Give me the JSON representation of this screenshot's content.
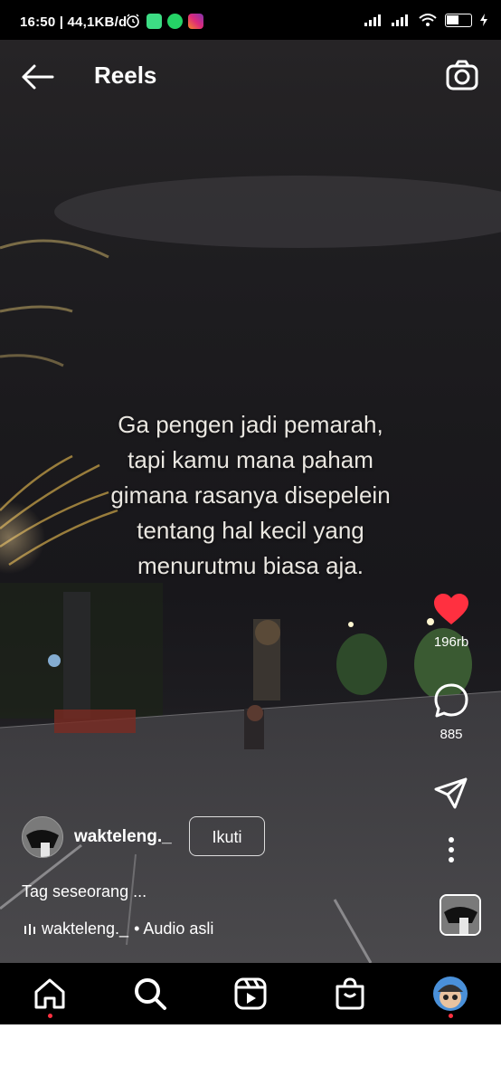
{
  "status_bar": {
    "time": "16:50",
    "network_speed": "44,1KB/d",
    "battery": "46"
  },
  "header": {
    "title": "Reels"
  },
  "caption": {
    "lines": [
      "Ga pengen jadi pemarah,",
      "tapi kamu mana paham",
      "gimana rasanya disepelein",
      "tentang hal kecil yang",
      "menurutmu biasa aja."
    ]
  },
  "actions": {
    "likes": "196rb",
    "comments": "885"
  },
  "post": {
    "username": "wakteleng._",
    "follow_label": "Ikuti",
    "tag_text": "Tag seseorang ...",
    "audio_user": "wakteleng._",
    "audio_suffix": "• Audio asli"
  },
  "colors": {
    "like_red": "#ff3040",
    "background": "#000000"
  },
  "icons": [
    "back-arrow",
    "camera",
    "heart",
    "comment",
    "share",
    "more-vertical",
    "home",
    "search",
    "reels",
    "shop",
    "profile-avatar"
  ]
}
